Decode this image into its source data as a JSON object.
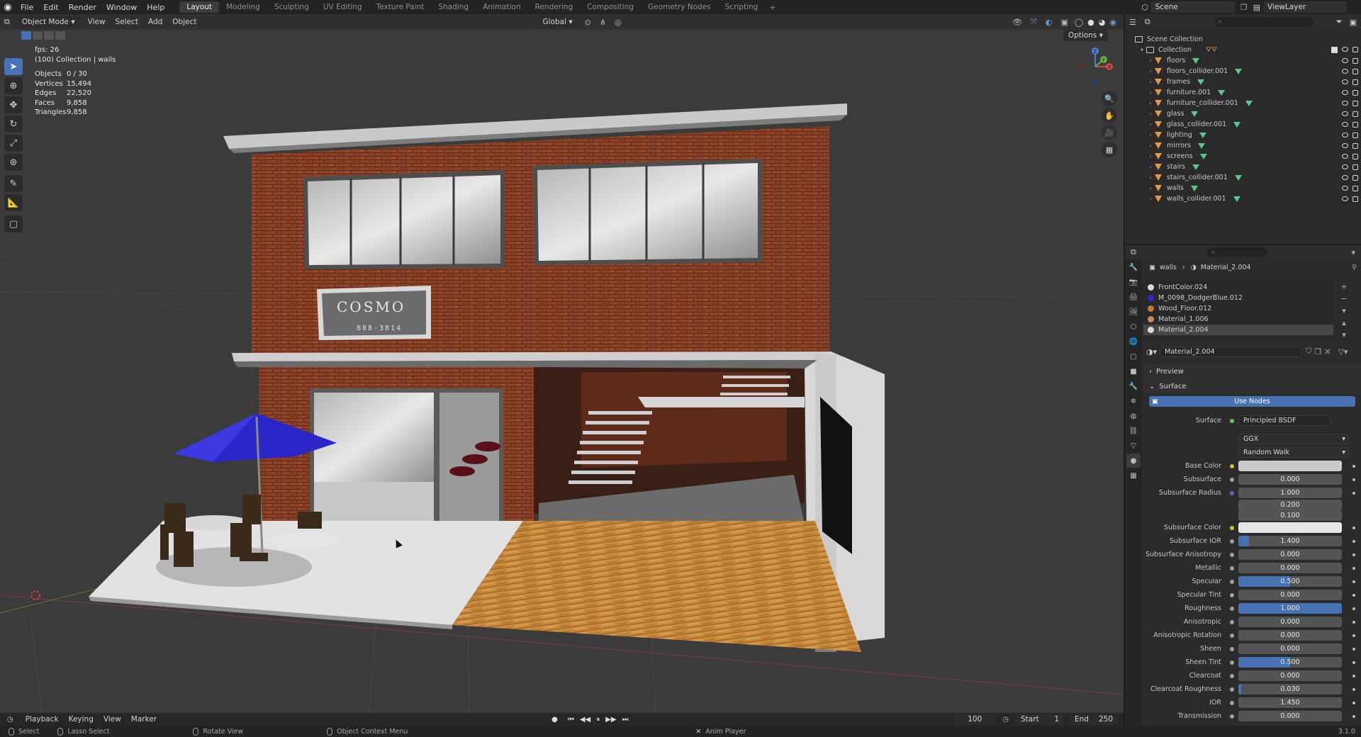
{
  "topbar": {
    "menus": [
      "File",
      "Edit",
      "Render",
      "Window",
      "Help"
    ],
    "workspaces": [
      "Layout",
      "Modeling",
      "Sculpting",
      "UV Editing",
      "Texture Paint",
      "Shading",
      "Animation",
      "Rendering",
      "Compositing",
      "Geometry Nodes",
      "Scripting"
    ],
    "active_workspace": "Layout",
    "scene_label": "Scene",
    "view_layer_label": "ViewLayer"
  },
  "viewport": {
    "mode": "Object Mode",
    "menus": [
      "View",
      "Select",
      "Add",
      "Object"
    ],
    "transform_orientation": "Global",
    "options_label": "Options",
    "stats": {
      "fps": "fps: 26",
      "collection_line": "(100) Collection | walls",
      "objects_label": "Objects",
      "objects_value": "0 / 30",
      "vertices_label": "Vertices",
      "vertices_value": "15,494",
      "edges_label": "Edges",
      "edges_value": "22,520",
      "faces_label": "Faces",
      "faces_value": "9,858",
      "triangles_label": "Triangles",
      "triangles_value": "9,858"
    },
    "sign_text": "COSMO",
    "sign_subtext": "888-3814",
    "gizmo_axes": [
      "X",
      "Y",
      "Z"
    ]
  },
  "timeline": {
    "menus": [
      "Playback",
      "Keying",
      "View",
      "Marker"
    ],
    "current_frame": "100",
    "start_label": "Start",
    "start_value": "1",
    "end_label": "End",
    "end_value": "250"
  },
  "statusbar": {
    "select": "Select",
    "lasso": "Lasso Select",
    "rotate": "Rotate View",
    "context_menu": "Object Context Menu",
    "anim_player": "Anim Player",
    "version": "3.1.0"
  },
  "outliner": {
    "root": "Scene Collection",
    "collection": "Collection",
    "items": [
      "floors",
      "floors_collider.001",
      "frames",
      "furniture.001",
      "furniture_collider.001",
      "glass",
      "glass_collider.001",
      "lighting",
      "mirrors",
      "screens",
      "stairs",
      "stairs_collider.001",
      "walls",
      "walls_collider.001"
    ]
  },
  "properties": {
    "breadcrumb_object": "walls",
    "breadcrumb_material": "Material_2.004",
    "material_slots": [
      {
        "name": "FrontColor.024",
        "color": "#d9d9d9"
      },
      {
        "name": "M_0098_DodgerBlue.012",
        "color": "#2b2bd9"
      },
      {
        "name": "Wood_Floor.012",
        "color": "#c07a3a"
      },
      {
        "name": "Material_1.006",
        "color": "#c98a5a"
      },
      {
        "name": "Material_2.004",
        "color": "#d9d9d9"
      }
    ],
    "active_material": "Material_2.004",
    "preview_label": "Preview",
    "surface_panel_label": "Surface",
    "use_nodes_label": "Use Nodes",
    "surface_label": "Surface",
    "surface_value": "Principled BSDF",
    "distribution": "GGX",
    "subsurface_method": "Random Walk",
    "fields": [
      {
        "label": "Base Color",
        "type": "color",
        "socket": "y",
        "color": "#cacaca"
      },
      {
        "label": "Subsurface",
        "value": "0.000",
        "fill": 0,
        "socket": "g"
      },
      {
        "label": "Subsurface Radius",
        "value": "1.000",
        "fill": 0,
        "socket": "b",
        "extra": [
          "0.200",
          "0.100"
        ]
      },
      {
        "label": "Subsurface Color",
        "type": "color",
        "socket": "y",
        "color": "#e6e6e6"
      },
      {
        "label": "Subsurface IOR",
        "value": "1.400",
        "fill": 0.1,
        "socket": "g"
      },
      {
        "label": "Subsurface Anisotropy",
        "value": "0.000",
        "fill": 0,
        "socket": "g"
      },
      {
        "label": "Metallic",
        "value": "0.000",
        "fill": 0,
        "socket": "g"
      },
      {
        "label": "Specular",
        "value": "0.500",
        "fill": 0.5,
        "socket": "g"
      },
      {
        "label": "Specular Tint",
        "value": "0.000",
        "fill": 0,
        "socket": "g"
      },
      {
        "label": "Roughness",
        "value": "1.000",
        "fill": 1,
        "socket": "g"
      },
      {
        "label": "Anisotropic",
        "value": "0.000",
        "fill": 0,
        "socket": "g"
      },
      {
        "label": "Anisotropic Rotation",
        "value": "0.000",
        "fill": 0,
        "socket": "g"
      },
      {
        "label": "Sheen",
        "value": "0.000",
        "fill": 0,
        "socket": "g"
      },
      {
        "label": "Sheen Tint",
        "value": "0.500",
        "fill": 0.5,
        "socket": "g"
      },
      {
        "label": "Clearcoat",
        "value": "0.000",
        "fill": 0,
        "socket": "g"
      },
      {
        "label": "Clearcoat Roughness",
        "value": "0.030",
        "fill": 0.03,
        "socket": "g"
      },
      {
        "label": "IOR",
        "value": "1.450",
        "fill": 0,
        "socket": "g"
      },
      {
        "label": "Transmission",
        "value": "0.000",
        "fill": 0,
        "socket": "g"
      }
    ]
  },
  "colors": {
    "accent": "#4772b3",
    "brick": "#8a3d22",
    "umbrella": "#2a26c8",
    "wood": "#c98a3c"
  }
}
